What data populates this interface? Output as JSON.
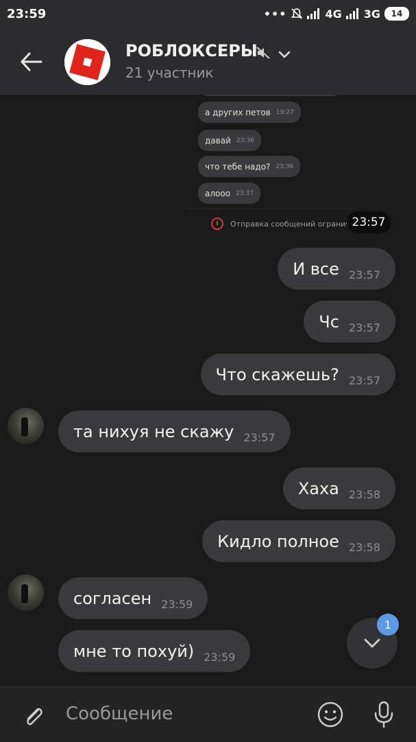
{
  "status_bar": {
    "time": "23:59",
    "net1": "4G",
    "net2": "3G",
    "battery": "14"
  },
  "header": {
    "title": "РОБЛОКСЕРЫ",
    "subtitle": "21 участник"
  },
  "forwarded": {
    "messages": [
      {
        "text": "а других петов",
        "time": "19:27"
      },
      {
        "text": "давай",
        "time": "23:36"
      },
      {
        "text": "что тебе надо?",
        "time": "23:36"
      },
      {
        "text": "алооо",
        "time": "23:37"
      }
    ],
    "warning": "Отправка сообщений ограничена",
    "timestamp": "23:57"
  },
  "messages": [
    {
      "text": "И все",
      "time": "23:57",
      "side": "out"
    },
    {
      "text": "Чс",
      "time": "23:57",
      "side": "out"
    },
    {
      "text": "Что скажешь?",
      "time": "23:57",
      "side": "out"
    },
    {
      "text": "та нихуя не скажу",
      "time": "23:57",
      "side": "in"
    },
    {
      "text": "Хаха",
      "time": "23:58",
      "side": "out"
    },
    {
      "text": "Кидло полное",
      "time": "23:58",
      "side": "out"
    },
    {
      "text": "согласен",
      "time": "23:59",
      "side": "in"
    },
    {
      "text": "мне то похуй)",
      "time": "23:59",
      "side": "in"
    }
  ],
  "scroll_badge": "1",
  "input": {
    "placeholder": "Сообщение"
  },
  "colors": {
    "bubble": "#3a3a3c",
    "background": "#1a1a1b",
    "header": "#2c2c2e",
    "badge": "#5b9be6",
    "roblox_red": "#e2231a"
  }
}
